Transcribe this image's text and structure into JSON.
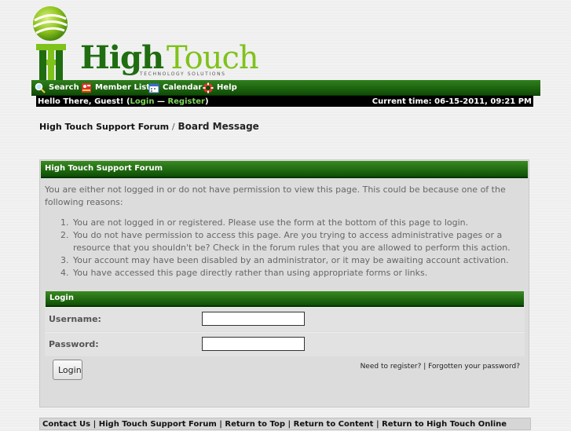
{
  "logo": {
    "word_high": "High",
    "word_touch": "Touch",
    "tagline": "TECHNOLOGY SOLUTIONS"
  },
  "menu": {
    "search": "Search",
    "member_list": "Member List",
    "calendar": "Calendar",
    "help": "Help"
  },
  "welcome": {
    "greeting": "Hello There, Guest! (",
    "login": "Login",
    "dash": " — ",
    "register": "Register",
    "close": ")",
    "time": "Current time: 06-15-2011, 09:21 PM"
  },
  "breadcrumb": {
    "forum": "High Touch Support Forum",
    "separator": "/",
    "current": "Board Message"
  },
  "panel": {
    "title": "High Touch Support Forum",
    "message": "You are either not logged in or do not have permission to view this page. This could be because one of the following reasons:",
    "reasons": [
      "You are not logged in or registered. Please use the form at the bottom of this page to login.",
      "You do not have permission to access this page. Are you trying to access administrative pages or a resource that you shouldn't be? Check in the forum rules that you are allowed to perform this action.",
      "Your account may have been disabled by an administrator, or it may be awaiting account activation.",
      "You have accessed this page directly rather than using appropriate forms or links."
    ]
  },
  "login": {
    "title": "Login",
    "username_label": "Username:",
    "username_value": "",
    "password_label": "Password:",
    "password_value": "",
    "button": "Login",
    "need_register": "Need to register?",
    "pipe": " | ",
    "forgot": "Forgotten your password?"
  },
  "footer": {
    "contact": "Contact Us",
    "forum": "High Touch Support Forum",
    "top": "Return to Top",
    "content": "Return to Content",
    "online": "Return to High Touch Online",
    "pipe": " | "
  },
  "colors": {
    "accent": "#1f6d10",
    "accent_light": "#7fc21a",
    "header_bg": "#0d5005"
  }
}
